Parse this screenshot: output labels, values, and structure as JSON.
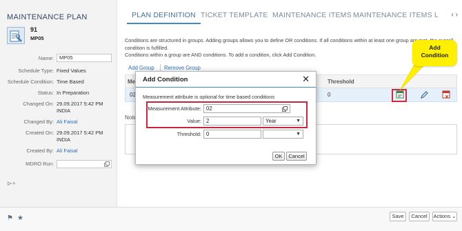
{
  "left_panel": {
    "title": "MAINTENANCE PLAN",
    "plan_number": "91",
    "plan_code": "MP05",
    "fields": {
      "name_label": "Name:",
      "name_value": "MP05",
      "schedule_type_label": "Schedule Type:",
      "schedule_type_value": "Fixed Values",
      "schedule_condition_label": "Schedule Condition:",
      "schedule_condition_value": "Time Based",
      "status_label": "Status:",
      "status_value": "In Preparation",
      "changed_on_label": "Changed On:",
      "changed_on_value": "29.09.2017 5:42 PM",
      "changed_on_tz": "INDIA",
      "changed_by_label": "Changed By:",
      "changed_by_value": "Ali Faisal",
      "created_on_label": "Created On:",
      "created_on_value": "29.09.2017 5:42 PM",
      "created_on_tz": "INDIA",
      "created_by_label": "Created By:",
      "created_by_value": "Ali Faisal",
      "mdro_run_label": "MDRO Run:"
    }
  },
  "tabs": {
    "plan_definition": "PLAN DEFINITION",
    "ticket_template": "TICKET TEMPLATE",
    "maintenance_items": "MAINTENANCE ITEMS",
    "maintenance_items_l": "MAINTENANCE ITEMS L",
    "arrows": "‹ ›"
  },
  "description": {
    "line1": "Conditions are structured in groups. Adding groups allows you to define OR conditions. If all conditions within at least one group are met, the overall",
    "line2": "condition is fulfilled.",
    "line3": "Conditions within a group are AND conditions. To add a condition, click Add Condition."
  },
  "toolbar": {
    "add_group": "Add Group",
    "remove_group": "Remove Group"
  },
  "table": {
    "col_me": "Me",
    "col_threshold": "Threshold",
    "row_id": "02",
    "row_threshold": "0"
  },
  "notes_label": "Note",
  "callout": {
    "line1": "Add",
    "line2": "Condition"
  },
  "modal": {
    "title": "Add Condition",
    "close": "✕",
    "hint": "Measurement attribute is optional for time based conditions",
    "measurement_attribute_label": "Measurement Attribute:",
    "measurement_attribute_value": "02",
    "value_label": "Value:",
    "value_value": "2",
    "value_unit": "Year",
    "threshold_label": "Threshold:",
    "threshold_value": "0",
    "threshold_unit": "",
    "ok": "OK",
    "cancel": "Cancel"
  },
  "footer": {
    "save": "Save",
    "cancel": "Cancel",
    "actions": "Actions",
    "actions_caret": "⌄"
  },
  "colors": {
    "accent": "#3f8bc6",
    "link": "#2a6fb4",
    "highlight_red": "#c8243a",
    "callout_yellow": "#ffef00"
  }
}
